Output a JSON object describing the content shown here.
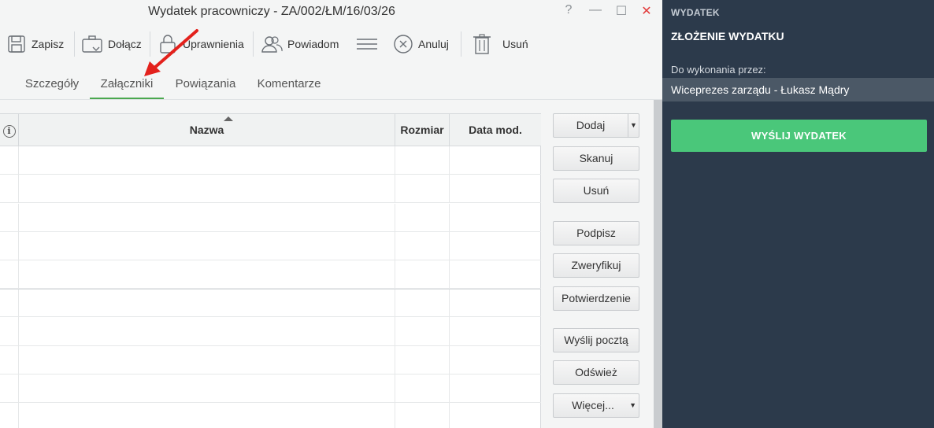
{
  "window": {
    "title": "Wydatek pracowniczy - ZA/002/ŁM/16/03/26",
    "help": "?",
    "minimize": "—",
    "maximize": "☐",
    "close": "✕"
  },
  "toolbar": {
    "save": "Zapisz",
    "attach": "Dołącz",
    "permissions": "Uprawnienia",
    "notify": "Powiadom",
    "cancel": "Anuluj",
    "delete": "Usuń"
  },
  "tabs": [
    "Szczegóły",
    "Załączniki",
    "Powiązania",
    "Komentarze"
  ],
  "active_tab": "Załączniki",
  "grid": {
    "info_icon": "i",
    "columns": [
      "Nazwa",
      "Rozmiar",
      "Data mod."
    ]
  },
  "actions": {
    "add": "Dodaj",
    "scan": "Skanuj",
    "remove": "Usuń",
    "sign": "Podpisz",
    "verify": "Zweryfikuj",
    "confirmation": "Potwierdzenie",
    "send_mail": "Wyślij pocztą",
    "refresh": "Odśwież",
    "more": "Więcej..."
  },
  "side": {
    "category": "WYDATEK",
    "step": "ZŁOŻENIE WYDATKU",
    "assigned_label": "Do wykonania przez:",
    "assignee": "Wiceprezes zarządu - Łukasz Mądry",
    "send_button": "WYŚLIJ WYDATEK"
  },
  "colors": {
    "sidebar_bg": "#2c3a4b",
    "send_button": "#4ac77a",
    "active_tab_underline": "#4aa84f",
    "annotation_arrow": "#e3211c"
  }
}
